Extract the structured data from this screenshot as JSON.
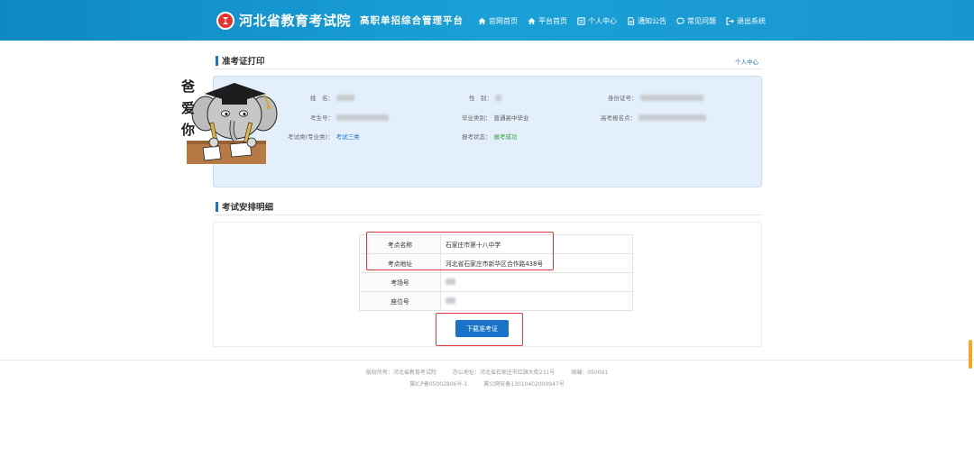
{
  "header": {
    "logo_title": "河北省教育考试院",
    "logo_subtitle": "高职单招综合管理平台",
    "nav": [
      {
        "label": "官网首页",
        "icon": "home-icon"
      },
      {
        "label": "平台首页",
        "icon": "home-icon"
      },
      {
        "label": "个人中心",
        "icon": "profile-icon"
      },
      {
        "label": "通知公告",
        "icon": "document-icon"
      },
      {
        "label": "常见问题",
        "icon": "chat-icon"
      },
      {
        "label": "退出系统",
        "icon": "logout-icon"
      }
    ]
  },
  "ticket": {
    "title": "准考证打印",
    "personal_link": "个人中心",
    "fields": {
      "name_label": "姓　名：",
      "gender_label": "性　别：",
      "id_label": "身份证号：",
      "candidate_no_label": "考生号：",
      "grad_type_label": "毕业类别：",
      "grad_type_value": "普通高中毕业",
      "reg_no_label": "高考报名点：",
      "exam_type_label": "考试类(专业类)：",
      "exam_type_value": "考试三类",
      "status_label": "报考状态：",
      "status_value": "报考成功"
    }
  },
  "sticker": {
    "caption": "爸爱你"
  },
  "arrangement": {
    "title": "考试安排明细",
    "rows": [
      {
        "key": "考点名称",
        "value": "石家庄市第十八中学"
      },
      {
        "key": "考点地址",
        "value": "河北省石家庄市新华区合作路438号"
      },
      {
        "key": "考场号",
        "value": ""
      },
      {
        "key": "座位号",
        "value": ""
      }
    ],
    "download_label": "下载准考证"
  },
  "footer": {
    "copyright": "版权所有：河北省教育考试院",
    "address": "办公地址：河北省石家庄市红旗大街231号",
    "postcode": "邮编：050091",
    "icp": "冀ICP备05002806号-1",
    "police": "冀公网安备13010402000947号"
  },
  "colors": {
    "header": "#1a96cf",
    "accent": "#1a73c8",
    "success": "#2e9e3a",
    "highlight": "#e03a3a"
  }
}
